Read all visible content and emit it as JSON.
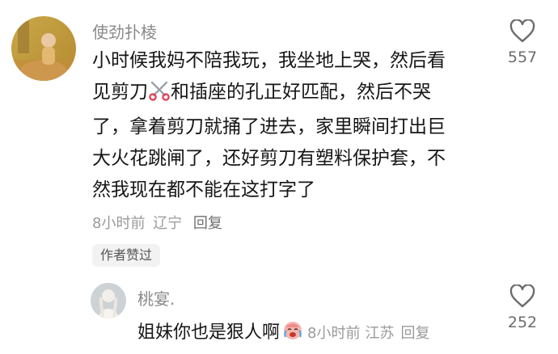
{
  "comment": {
    "username": "使劲扑棱",
    "text_line1": "小时候我妈不陪我玩，我坐地上哭，然后看",
    "text_line2a": "见剪刀",
    "emoji_icon": "scissors-icon",
    "text_line2b": "和插座的孔正好匹配，然后不哭",
    "text_line3": "了，拿着剪刀就捅了进去，家里瞬间打出巨",
    "text_line4": "大火花跳闸了，还好剪刀有塑料保护套，不",
    "text_line5": "然我现在都不能在这打字了",
    "time": "8小时前",
    "location": "辽宁",
    "reply_label": "回复",
    "badge": "作者赞过",
    "likes": "557"
  },
  "reply": {
    "username": "桃宴.",
    "text": "姐妹你也是狠人啊",
    "emoji_icon": "crying-laugh-icon",
    "time": "8小时前",
    "location": "江苏",
    "reply_label": "回复",
    "likes": "252"
  },
  "colors": {
    "text": "#161616",
    "secondary": "#8a8a8a",
    "badge_bg": "#f2f2f2"
  }
}
